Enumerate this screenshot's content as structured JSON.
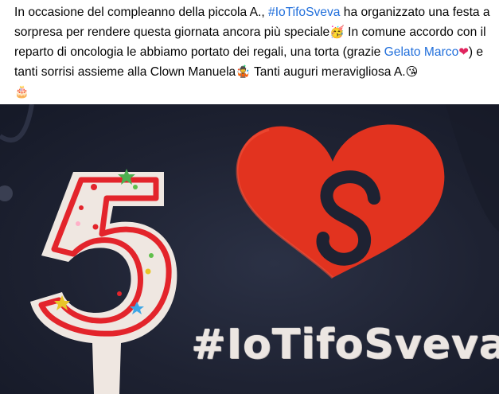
{
  "post": {
    "text_1": "In occasione del compleanno della piccola A., ",
    "hashtag_link": "#IoTifoSveva",
    "text_2": " ha organizzato una festa a sorpresa per rendere questa giornata ancora più speciale",
    "emoji_party": "🥳",
    "text_3": " In comune accordo con il reparto di oncologia le abbiamo portato dei regali, una torta (grazie ",
    "page_link": "Gelato Marco",
    "emoji_heart": "❤",
    "text_4": ") e tanti sorrisi assieme alla Clown Manuela",
    "emoji_clown": "🤹",
    "text_5": " Tanti auguri meravigliosa A.",
    "emoji_kiss": "😘",
    "emoji_cake": "🎂"
  },
  "photo": {
    "embroidered_text": "#IoTifoSveva",
    "candle_number": "5",
    "heart_letter": "S"
  },
  "colors": {
    "link": "#216fdb",
    "fabric": "#1e2232",
    "heart": "#e2331f",
    "candle_red": "#e3242b"
  }
}
